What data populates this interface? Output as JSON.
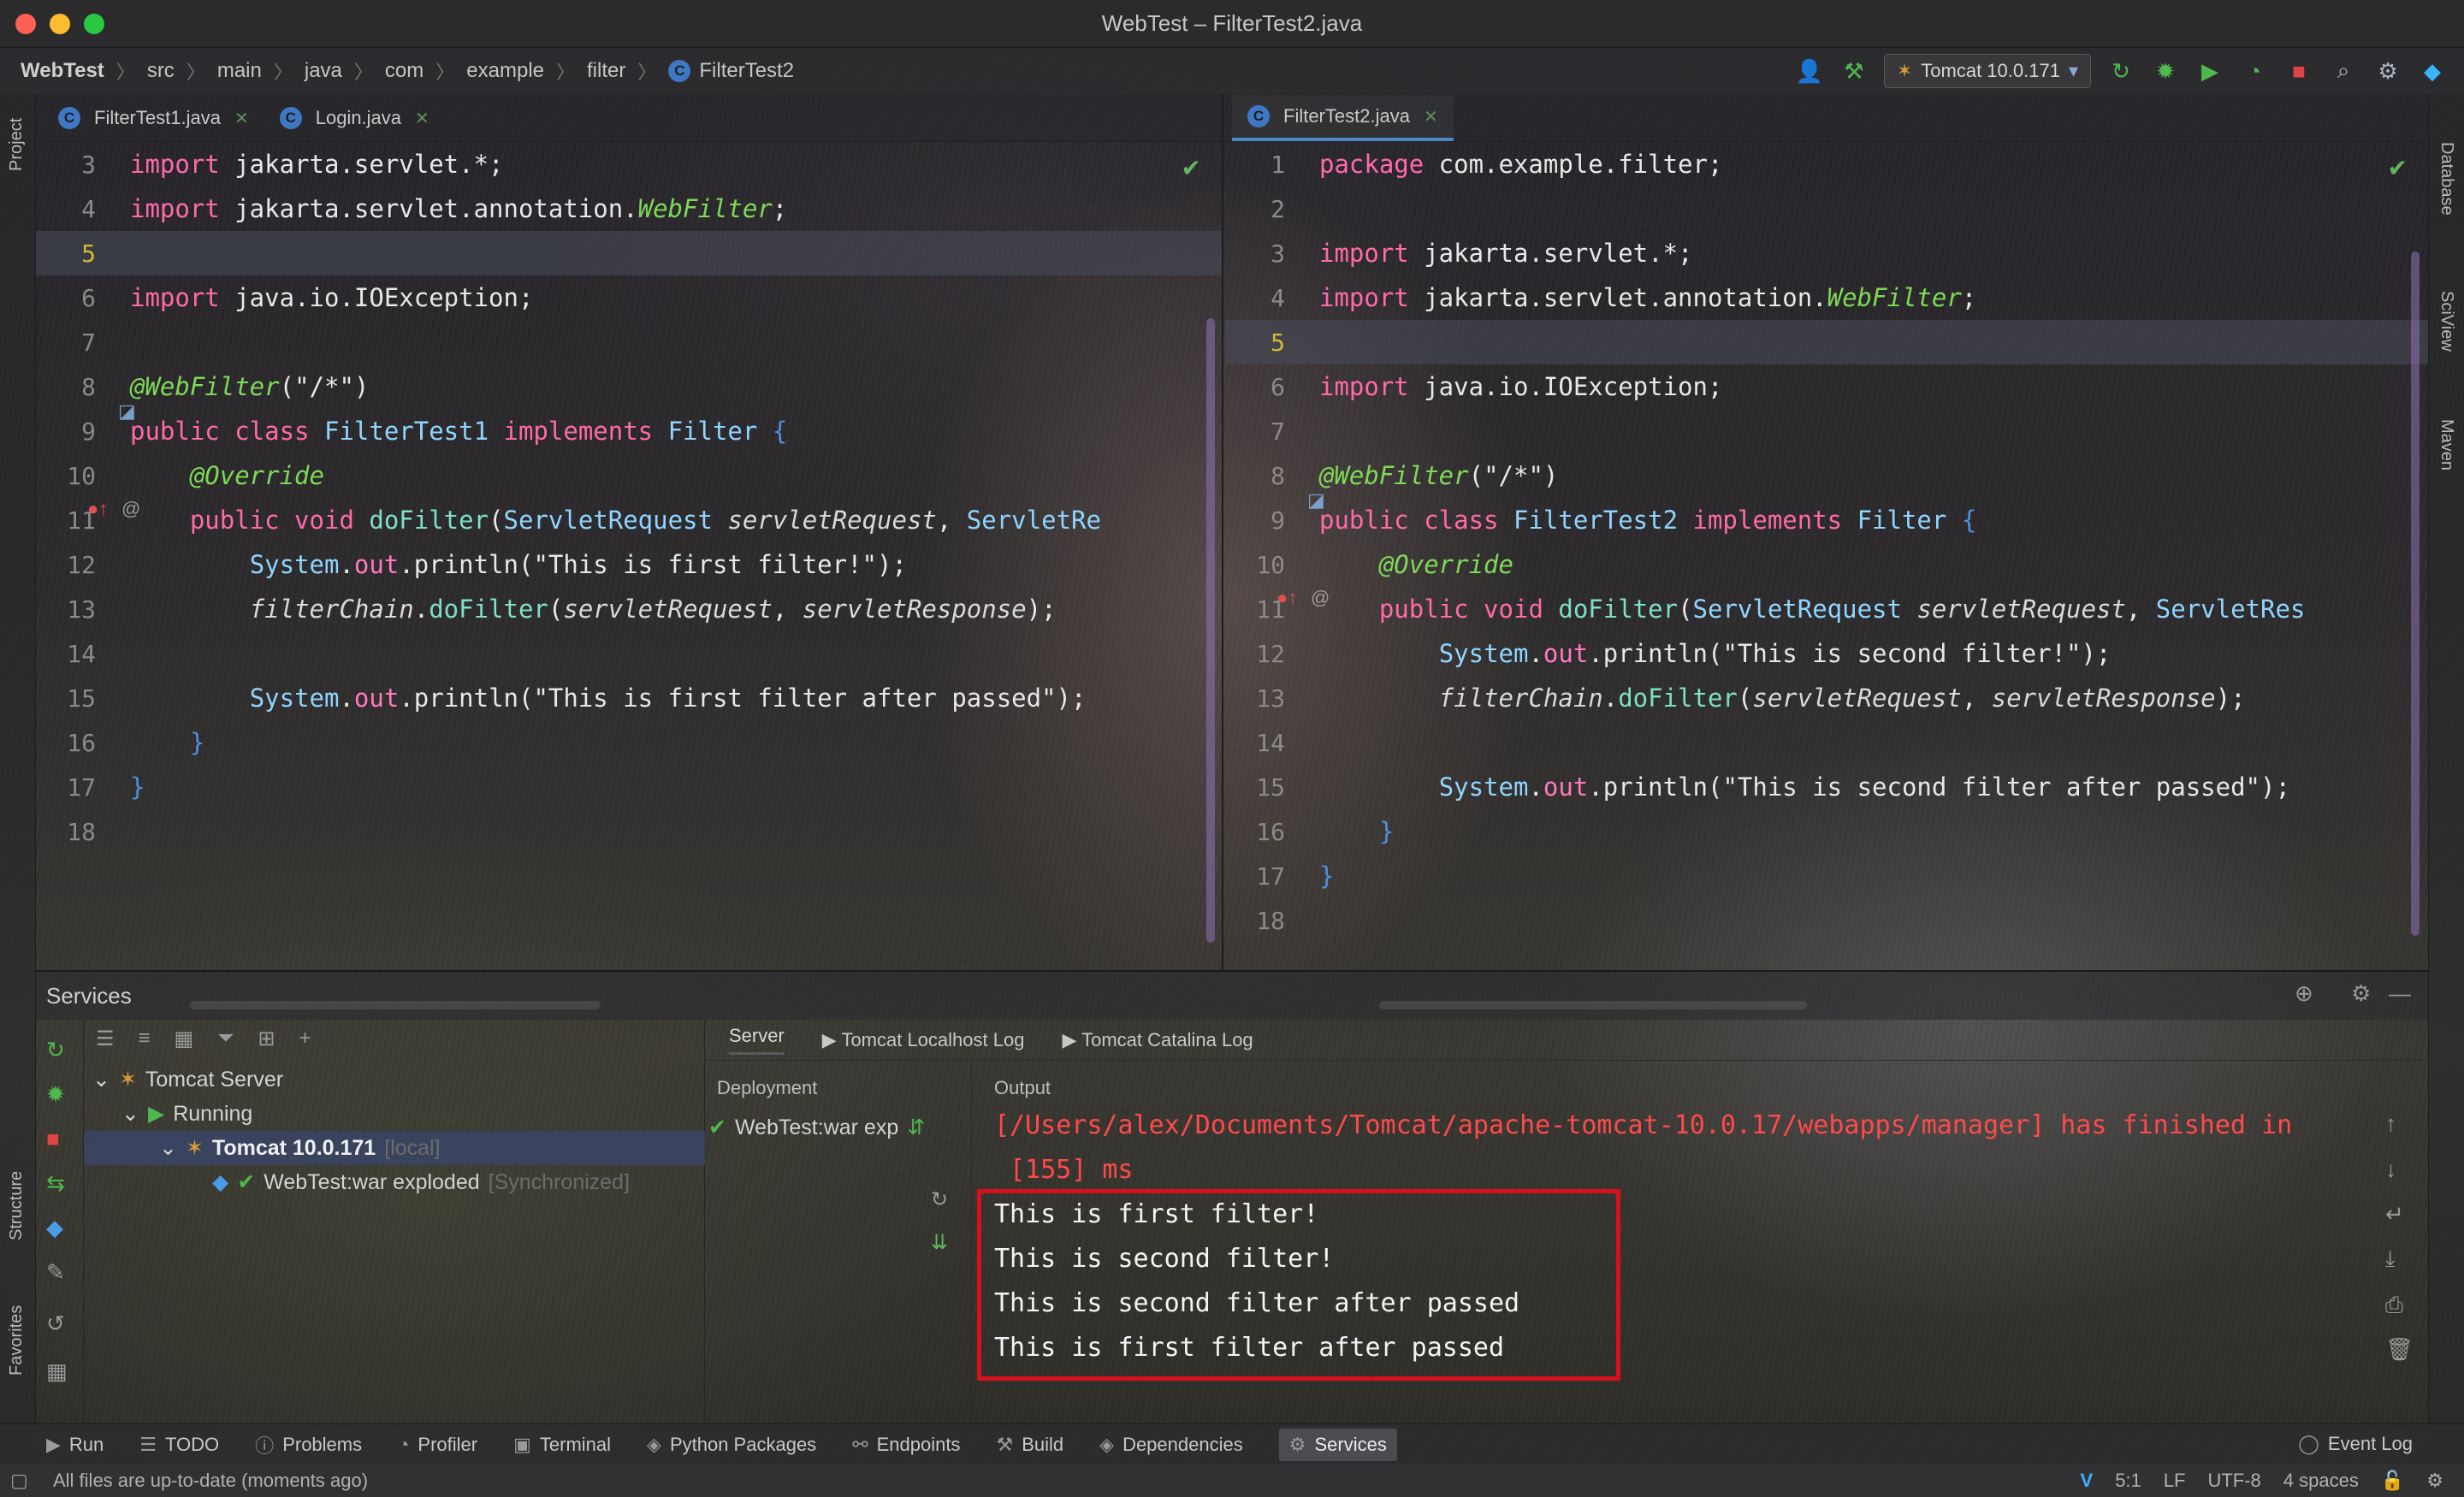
{
  "window": {
    "title": "WebTest – FilterTest2.java"
  },
  "breadcrumbs": [
    "WebTest",
    "src",
    "main",
    "java",
    "com",
    "example",
    "filter",
    "FilterTest2"
  ],
  "toolbar": {
    "run_config": "Tomcat 10.0.171"
  },
  "left_strip": {
    "project": "Project",
    "structure": "Structure",
    "favorites": "Favorites"
  },
  "right_strip": {
    "database": "Database",
    "sciview": "SciView",
    "maven": "Maven"
  },
  "editor_left": {
    "tabs": [
      {
        "label": "FilterTest1.java"
      },
      {
        "label": "Login.java"
      }
    ],
    "lines": [
      {
        "n": "3",
        "t": "import jakarta.servlet.*;"
      },
      {
        "n": "4",
        "t": "import jakarta.servlet.annotation.WebFilter;"
      },
      {
        "n": "5",
        "t": ""
      },
      {
        "n": "6",
        "t": "import java.io.IOException;"
      },
      {
        "n": "7",
        "t": ""
      },
      {
        "n": "8",
        "t": "@WebFilter(\"/*\")"
      },
      {
        "n": "9",
        "t": "public class FilterTest1 implements Filter {"
      },
      {
        "n": "10",
        "t": "    @Override"
      },
      {
        "n": "11",
        "t": "    public void doFilter(ServletRequest servletRequest, ServletRe"
      },
      {
        "n": "12",
        "t": "        System.out.println(\"This is first filter!\");"
      },
      {
        "n": "13",
        "t": "        filterChain.doFilter(servletRequest, servletResponse);"
      },
      {
        "n": "14",
        "t": ""
      },
      {
        "n": "15",
        "t": "        System.out.println(\"This is first filter after passed\");"
      },
      {
        "n": "16",
        "t": "    }"
      },
      {
        "n": "17",
        "t": "}"
      },
      {
        "n": "18",
        "t": ""
      }
    ]
  },
  "editor_right": {
    "tabs": [
      {
        "label": "FilterTest2.java"
      }
    ],
    "lines": [
      {
        "n": "1",
        "t": "package com.example.filter;"
      },
      {
        "n": "2",
        "t": ""
      },
      {
        "n": "3",
        "t": "import jakarta.servlet.*;"
      },
      {
        "n": "4",
        "t": "import jakarta.servlet.annotation.WebFilter;"
      },
      {
        "n": "5",
        "t": ""
      },
      {
        "n": "6",
        "t": "import java.io.IOException;"
      },
      {
        "n": "7",
        "t": ""
      },
      {
        "n": "8",
        "t": "@WebFilter(\"/*\")"
      },
      {
        "n": "9",
        "t": "public class FilterTest2 implements Filter {"
      },
      {
        "n": "10",
        "t": "    @Override"
      },
      {
        "n": "11",
        "t": "    public void doFilter(ServletRequest servletRequest, ServletRes"
      },
      {
        "n": "12",
        "t": "        System.out.println(\"This is second filter!\");"
      },
      {
        "n": "13",
        "t": "        filterChain.doFilter(servletRequest, servletResponse);"
      },
      {
        "n": "14",
        "t": ""
      },
      {
        "n": "15",
        "t": "        System.out.println(\"This is second filter after passed\");"
      },
      {
        "n": "16",
        "t": "    }"
      },
      {
        "n": "17",
        "t": "}"
      },
      {
        "n": "18",
        "t": ""
      }
    ]
  },
  "services": {
    "title": "Services",
    "tree": {
      "server": "Tomcat Server",
      "running": "Running",
      "tomcat": "Tomcat 10.0.171",
      "tomcat_suffix": "[local]",
      "artifact": "WebTest:war exploded",
      "artifact_suffix": "[Synchronized]"
    },
    "tabs": [
      "Server",
      "Tomcat Localhost Log",
      "Tomcat Catalina Log"
    ],
    "deployment_header": "Deployment",
    "output_header": "Output",
    "deployment_item": "WebTest:war exp",
    "output": {
      "err1": "[/Users/alex/Documents/Tomcat/apache-tomcat-10.0.17/webapps/manager] has finished in",
      "err2": "[155] ms",
      "lines": [
        "This is first filter!",
        "This is second filter!",
        "This is second filter after passed",
        "This is first filter after passed"
      ]
    }
  },
  "bottom_tools": [
    "Run",
    "TODO",
    "Problems",
    "Profiler",
    "Terminal",
    "Python Packages",
    "Endpoints",
    "Build",
    "Dependencies",
    "Services"
  ],
  "event_log": "Event Log",
  "status": {
    "message": "All files are up-to-date (moments ago)",
    "position": "5:1",
    "line_sep": "LF",
    "encoding": "UTF-8",
    "indent": "4 spaces"
  },
  "colors": {
    "highlight_box": "#d8101e",
    "accent": "#4a88c7"
  }
}
